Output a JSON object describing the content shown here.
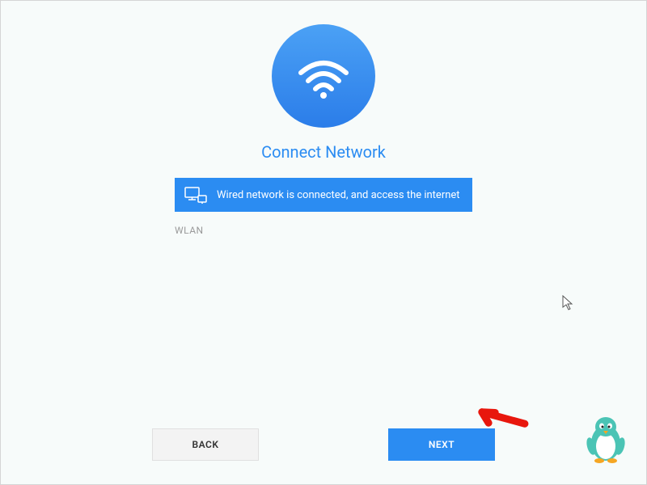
{
  "title": "Connect Network",
  "status": {
    "text": "Wired network is connected, and access the internet"
  },
  "section_label": "WLAN",
  "buttons": {
    "back": "BACK",
    "next": "NEXT"
  },
  "colors": {
    "primary": "#2b8cf2"
  }
}
